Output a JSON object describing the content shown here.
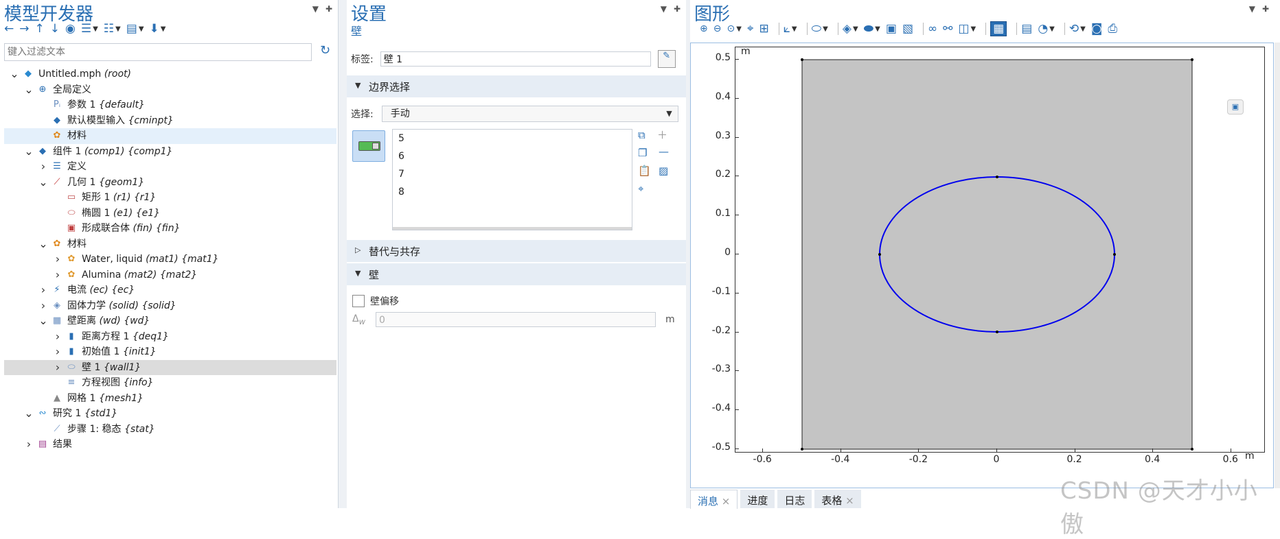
{
  "left": {
    "title": "模型开发器",
    "filter_placeholder": "键入过滤文本",
    "tree": [
      {
        "indent": 0,
        "arrow": "open",
        "icon": "root",
        "text": "Untitled.mph",
        "tag": "(root)"
      },
      {
        "indent": 1,
        "arrow": "open",
        "icon": "globe",
        "text": "全局定义",
        "tag": ""
      },
      {
        "indent": 2,
        "arrow": "",
        "icon": "param",
        "text": "参数 1",
        "tag": "{default}"
      },
      {
        "indent": 2,
        "arrow": "",
        "icon": "input",
        "text": "默认模型输入",
        "tag": "{cminpt}"
      },
      {
        "indent": 2,
        "arrow": "",
        "icon": "material",
        "text": "材料",
        "tag": "",
        "state": "hl"
      },
      {
        "indent": 1,
        "arrow": "open",
        "icon": "component",
        "text": "组件 1",
        "tag": "(comp1) {comp1}"
      },
      {
        "indent": 2,
        "arrow": "closed",
        "icon": "definitions",
        "text": "定义",
        "tag": ""
      },
      {
        "indent": 2,
        "arrow": "open",
        "icon": "geometry",
        "text": "几何 1",
        "tag": "{geom1}"
      },
      {
        "indent": 3,
        "arrow": "",
        "icon": "rectangle",
        "text": "矩形 1",
        "tag": "(r1) {r1}"
      },
      {
        "indent": 3,
        "arrow": "",
        "icon": "ellipse",
        "text": "椭圆 1",
        "tag": "(e1) {e1}"
      },
      {
        "indent": 3,
        "arrow": "",
        "icon": "union",
        "text": "形成联合体",
        "tag": "(fin) {fin}"
      },
      {
        "indent": 2,
        "arrow": "open",
        "icon": "material",
        "text": "材料",
        "tag": ""
      },
      {
        "indent": 3,
        "arrow": "closed",
        "icon": "material-item",
        "text": "Water, liquid",
        "tag": "(mat1) {mat1}"
      },
      {
        "indent": 3,
        "arrow": "closed",
        "icon": "material-item",
        "text": "Alumina",
        "tag": "(mat2) {mat2}"
      },
      {
        "indent": 2,
        "arrow": "closed",
        "icon": "current",
        "text": "电流",
        "tag": "(ec) {ec}"
      },
      {
        "indent": 2,
        "arrow": "closed",
        "icon": "solid",
        "text": "固体力学",
        "tag": "(solid) {solid}"
      },
      {
        "indent": 2,
        "arrow": "open",
        "icon": "wall-distance",
        "text": "壁距离",
        "tag": "(wd) {wd}"
      },
      {
        "indent": 3,
        "arrow": "closed",
        "icon": "equation",
        "text": "距离方程 1",
        "tag": "{deq1}"
      },
      {
        "indent": 3,
        "arrow": "closed",
        "icon": "initial",
        "text": "初始值 1",
        "tag": "{init1}"
      },
      {
        "indent": 3,
        "arrow": "closed",
        "icon": "wall",
        "text": "壁 1",
        "tag": "{wall1}",
        "state": "sel"
      },
      {
        "indent": 3,
        "arrow": "",
        "icon": "eqview",
        "text": "方程视图",
        "tag": "{info}"
      },
      {
        "indent": 2,
        "arrow": "",
        "icon": "mesh",
        "text": "网格 1",
        "tag": "{mesh1}"
      },
      {
        "indent": 1,
        "arrow": "open",
        "icon": "study",
        "text": "研究 1",
        "tag": "{std1}"
      },
      {
        "indent": 2,
        "arrow": "",
        "icon": "step",
        "text": "步骤 1: 稳态",
        "tag": "{stat}"
      },
      {
        "indent": 1,
        "arrow": "closed",
        "icon": "results",
        "text": "结果",
        "tag": ""
      }
    ]
  },
  "mid": {
    "title": "设置",
    "subtitle": "壁",
    "label_caption": "标签:",
    "label_value": "壁 1",
    "section_boundary": "边界选择",
    "select_caption": "选择:",
    "select_value": "手动",
    "boundaries": [
      "5",
      "6",
      "7",
      "8"
    ],
    "section_override": "替代与共存",
    "section_wall": "壁",
    "wall_offset_label": "壁偏移",
    "delta_symbol": "Δ",
    "delta_sub": "w",
    "delta_value": "0",
    "delta_unit": "m"
  },
  "right": {
    "title": "图形",
    "unit_top": "m",
    "unit_right": "m",
    "y_ticks": [
      "0.5",
      "0.4",
      "0.3",
      "0.2",
      "0.1",
      "0",
      "-0.1",
      "-0.2",
      "-0.3",
      "-0.4",
      "-0.5"
    ],
    "x_ticks": [
      "-0.6",
      "-0.4",
      "-0.2",
      "0",
      "0.2",
      "0.4",
      "0.6"
    ]
  },
  "bottom_tabs": [
    "消息",
    "进度",
    "日志",
    "表格"
  ],
  "watermark": "CSDN @天才小小傲",
  "colors": {
    "accent": "#2a6fb3",
    "ellipse": "#0000ee",
    "rect_fill": "#c4c4c4"
  }
}
